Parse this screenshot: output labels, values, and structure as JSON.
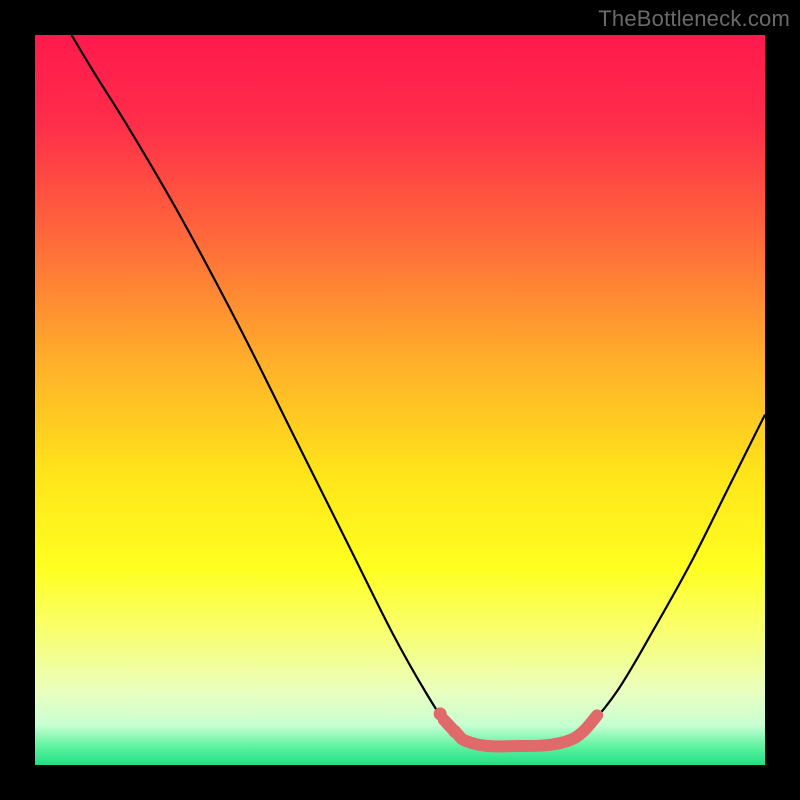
{
  "watermark": "TheBottleneck.com",
  "chart_data": {
    "type": "line",
    "title": "",
    "xlabel": "",
    "ylabel": "",
    "xlim": [
      0,
      100
    ],
    "ylim": [
      0,
      100
    ],
    "background_gradient_stops": [
      {
        "pos": 0.0,
        "color": "#ff1a4d"
      },
      {
        "pos": 0.12,
        "color": "#ff2d4a"
      },
      {
        "pos": 0.28,
        "color": "#ff6a3a"
      },
      {
        "pos": 0.45,
        "color": "#ffb02a"
      },
      {
        "pos": 0.6,
        "color": "#ffe41a"
      },
      {
        "pos": 0.73,
        "color": "#ffff20"
      },
      {
        "pos": 0.82,
        "color": "#f8ff72"
      },
      {
        "pos": 0.9,
        "color": "#eaffc0"
      },
      {
        "pos": 0.945,
        "color": "#c8ffd2"
      },
      {
        "pos": 0.975,
        "color": "#5ef2a0"
      },
      {
        "pos": 1.0,
        "color": "#20e084"
      }
    ],
    "series": [
      {
        "name": "bottleneck-curve",
        "color": "#000000",
        "width": 2.2,
        "points": [
          {
            "x": 5.0,
            "y": 100.0
          },
          {
            "x": 8.0,
            "y": 95.0
          },
          {
            "x": 13.0,
            "y": 87.0
          },
          {
            "x": 20.0,
            "y": 75.0
          },
          {
            "x": 28.0,
            "y": 60.0
          },
          {
            "x": 36.0,
            "y": 44.0
          },
          {
            "x": 43.0,
            "y": 30.0
          },
          {
            "x": 49.0,
            "y": 18.0
          },
          {
            "x": 53.5,
            "y": 10.0
          },
          {
            "x": 56.5,
            "y": 5.5
          },
          {
            "x": 59.0,
            "y": 3.3
          },
          {
            "x": 62.0,
            "y": 2.6
          },
          {
            "x": 66.0,
            "y": 2.6
          },
          {
            "x": 70.0,
            "y": 2.7
          },
          {
            "x": 73.0,
            "y": 3.3
          },
          {
            "x": 76.0,
            "y": 5.5
          },
          {
            "x": 80.0,
            "y": 10.5
          },
          {
            "x": 85.0,
            "y": 19.0
          },
          {
            "x": 90.0,
            "y": 28.0
          },
          {
            "x": 95.0,
            "y": 38.0
          },
          {
            "x": 100.0,
            "y": 48.0
          }
        ]
      },
      {
        "name": "highlight-segment",
        "color": "#e06a6a",
        "width": 12,
        "linecap": "round",
        "points": [
          {
            "x": 56.0,
            "y": 6.2
          },
          {
            "x": 57.8,
            "y": 4.3
          },
          {
            "x": 59.0,
            "y": 3.3
          },
          {
            "x": 62.0,
            "y": 2.6
          },
          {
            "x": 66.0,
            "y": 2.6
          },
          {
            "x": 70.0,
            "y": 2.7
          },
          {
            "x": 73.0,
            "y": 3.3
          },
          {
            "x": 75.0,
            "y": 4.5
          },
          {
            "x": 77.0,
            "y": 6.8
          }
        ]
      }
    ],
    "markers": [
      {
        "x": 55.5,
        "y": 7.0,
        "r": 6.5,
        "color": "#e06a6a"
      },
      {
        "x": 57.5,
        "y": 4.6,
        "r": 6.5,
        "color": "#e06a6a"
      }
    ]
  }
}
